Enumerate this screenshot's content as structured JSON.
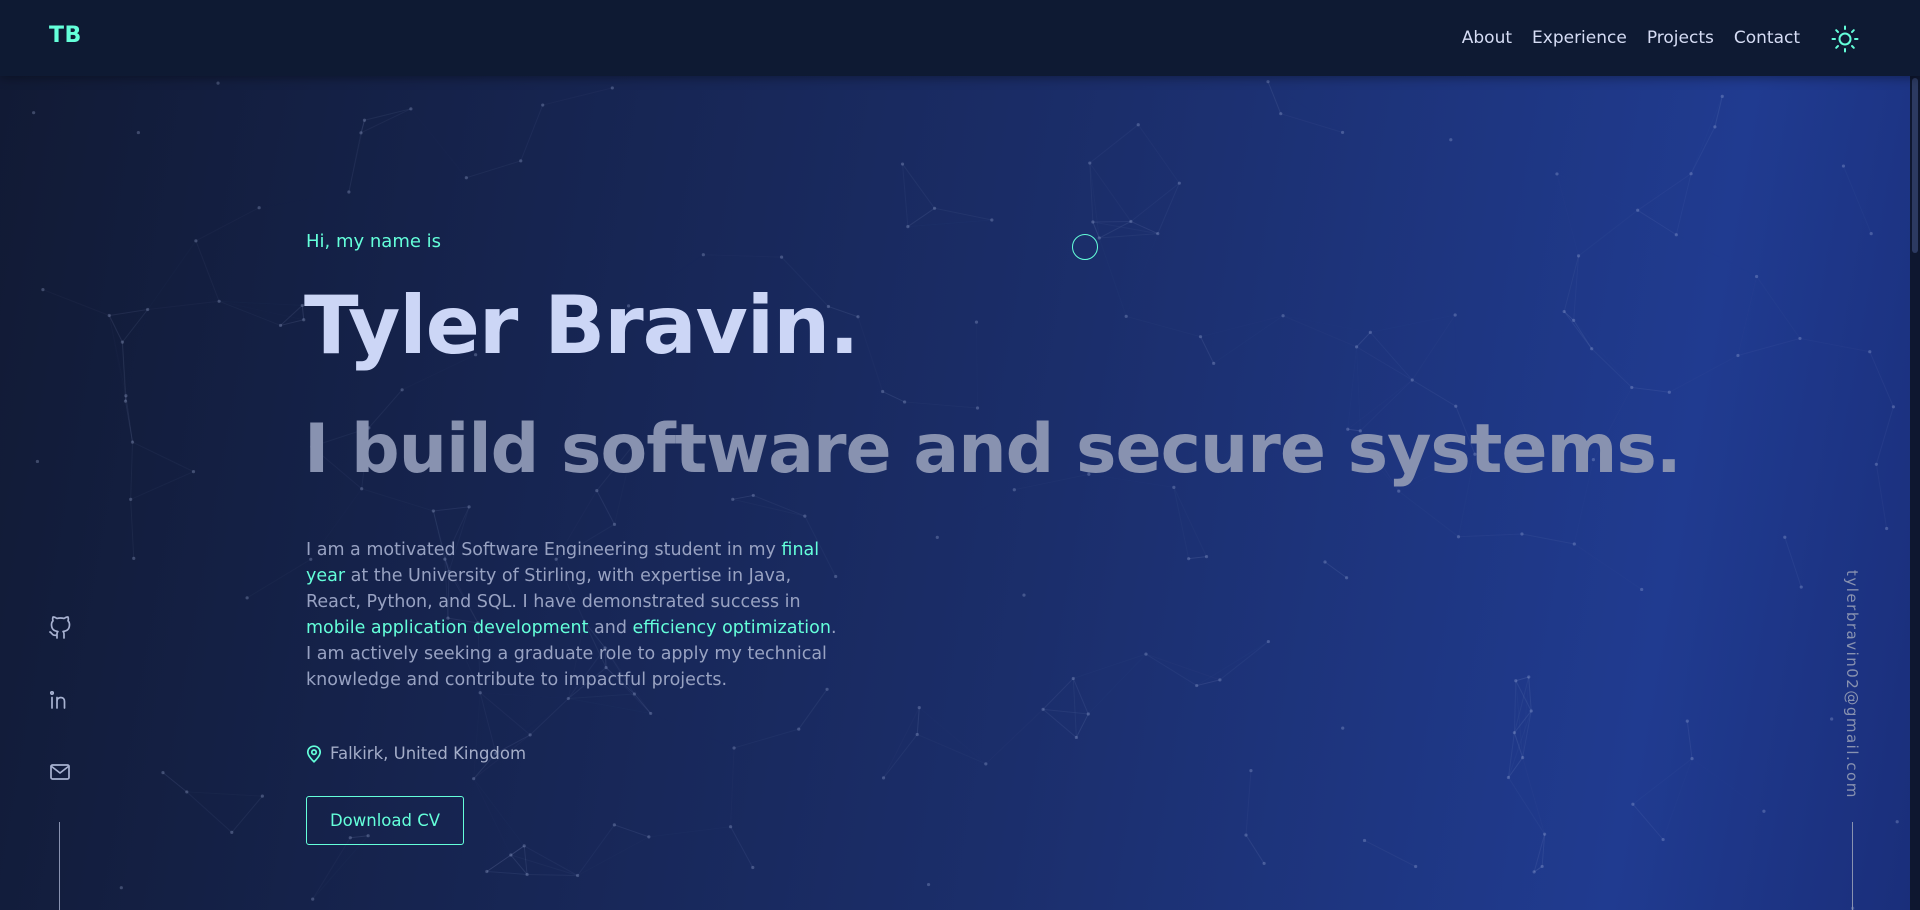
{
  "header": {
    "logo": "TB",
    "nav": [
      "About",
      "Experience",
      "Projects",
      "Contact"
    ],
    "theme_toggle_icon": "sun-icon"
  },
  "hero": {
    "greeting": "Hi, my name is",
    "name": "Tyler Bravin.",
    "tagline": "I build software and secure systems.",
    "bio": {
      "p1": "I am a motivated Software Engineering student in my ",
      "hl1": "final year",
      "p2": " at the University of Stirling, with expertise in Java, React, Python, and SQL. I have demonstrated success in ",
      "hl2": "mobile application development",
      "p3": " and ",
      "hl3": "efficiency optimization",
      "p4": ".",
      "p5": "I am actively seeking a graduate role to apply my technical knowledge and contribute to impactful projects."
    },
    "location": "Falkirk, United Kingdom",
    "location_icon": "map-pin-icon",
    "cv_button": "Download CV"
  },
  "social": {
    "items": [
      "github-icon",
      "linkedin-icon",
      "mail-icon"
    ],
    "email": "tylerbravin02@gmail.com"
  },
  "colors": {
    "accent": "#64ffda",
    "heading": "#ccd6f6",
    "muted": "#8892b0",
    "navbar": "#0e1a33"
  }
}
